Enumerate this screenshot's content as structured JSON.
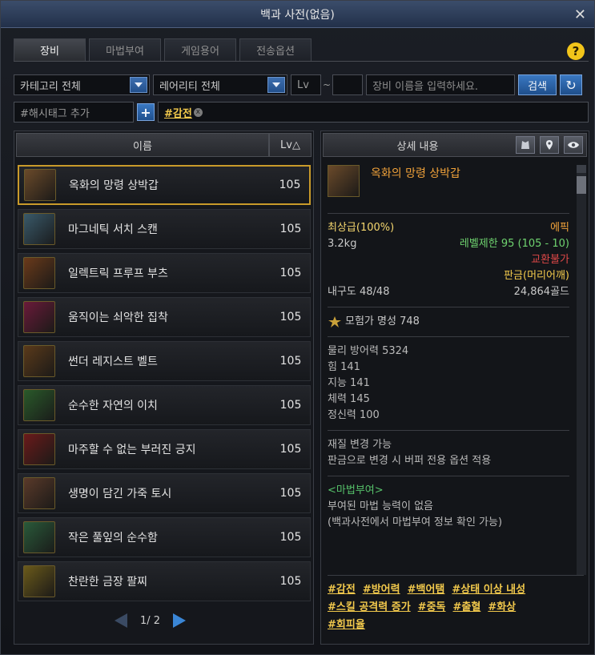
{
  "window": {
    "title": "백과 사전(없음)",
    "close_glyph": "✕"
  },
  "tabs": [
    {
      "label": "장비",
      "active": true
    },
    {
      "label": "마법부여",
      "active": false
    },
    {
      "label": "게임용어",
      "active": false
    },
    {
      "label": "전송옵션",
      "active": false
    }
  ],
  "help": {
    "glyph": "?"
  },
  "filters": {
    "category": "카테고리 전체",
    "rarity": "레어리티 전체",
    "lv_label": "Lv",
    "lv_sep": "~",
    "name_placeholder": "장비 이름을 입력하세요.",
    "search_label": "검색",
    "refresh_glyph": "↻"
  },
  "hashtags": {
    "add_placeholder": "#해시태그 추가",
    "add_glyph": "+",
    "active_tag": "#감전",
    "remove_glyph": "x"
  },
  "list": {
    "col_name": "이름",
    "col_lv": "Lv△",
    "items": [
      {
        "name": "옥화의 망령 상박갑",
        "lv": "105",
        "icon": "bracer-icon",
        "color": "#6a4a2a"
      },
      {
        "name": "마그네틱 서치 스캔",
        "lv": "105",
        "icon": "scanner-icon",
        "color": "#3a5a6a"
      },
      {
        "name": "일렉트릭 프루프 부츠",
        "lv": "105",
        "icon": "boots-icon",
        "color": "#6a3a1a"
      },
      {
        "name": "움직이는 쇠악한 집착",
        "lv": "105",
        "icon": "claw-icon",
        "color": "#6a1a3a"
      },
      {
        "name": "썬더 레지스트 벨트",
        "lv": "105",
        "icon": "belt-icon",
        "color": "#5a3a1a"
      },
      {
        "name": "순수한 자연의 이치",
        "lv": "105",
        "icon": "flower-icon",
        "color": "#2a5a2a"
      },
      {
        "name": "마주할 수 없는 부러진 긍지",
        "lv": "105",
        "icon": "gauntlet-icon",
        "color": "#6a1a1a"
      },
      {
        "name": "생명이 담긴 가죽 토시",
        "lv": "105",
        "icon": "sleeve-icon",
        "color": "#5a3a2a"
      },
      {
        "name": "작은 풀잎의 순수함",
        "lv": "105",
        "icon": "leaf-icon",
        "color": "#2a5a3a"
      },
      {
        "name": "찬란한 금장 팔찌",
        "lv": "105",
        "icon": "bracelet-icon",
        "color": "#6a5a1a"
      }
    ],
    "page": "1/ 2"
  },
  "detail": {
    "header": "상세 내용",
    "item_name": "옥화의 망령 상박갑",
    "grade": "최상급(100%)",
    "rarity": "에픽",
    "weight": "3.2kg",
    "level_limit": "레벨제한 95 (105 - 10)",
    "trade": "교환불가",
    "sell": "판금(머리어깨)",
    "durability": "내구도 48/48",
    "price": "24,864골드",
    "fame": "모험가 명성 748",
    "stats": [
      "물리 방어력 5324",
      "힘 141",
      "지능 141",
      "체력 145",
      "정신력 100"
    ],
    "notes": [
      "재질 변경 가능",
      "판금으로 변경 시 버퍼 전용 옵션 적용"
    ],
    "enchant_title": "<마법부여>",
    "enchant_lines": [
      "부여된 마법 능력이 없음",
      "(백과사전에서 마법부여 정보 확인 가능)"
    ],
    "tags": [
      "#감전",
      "#방어력",
      "#백어탬",
      "#상태 이상 내성",
      "#스킬 공격력 증가",
      "#중독",
      "#출혈",
      "#화상",
      "#회피율"
    ]
  },
  "colors": {
    "epic": "#f2a33a",
    "grade": "#f5d76e",
    "level": "#6fd36f",
    "no_trade": "#e04848",
    "sell": "#f2c94c",
    "enchant": "#56c16a",
    "tag": "#f2c94c"
  }
}
